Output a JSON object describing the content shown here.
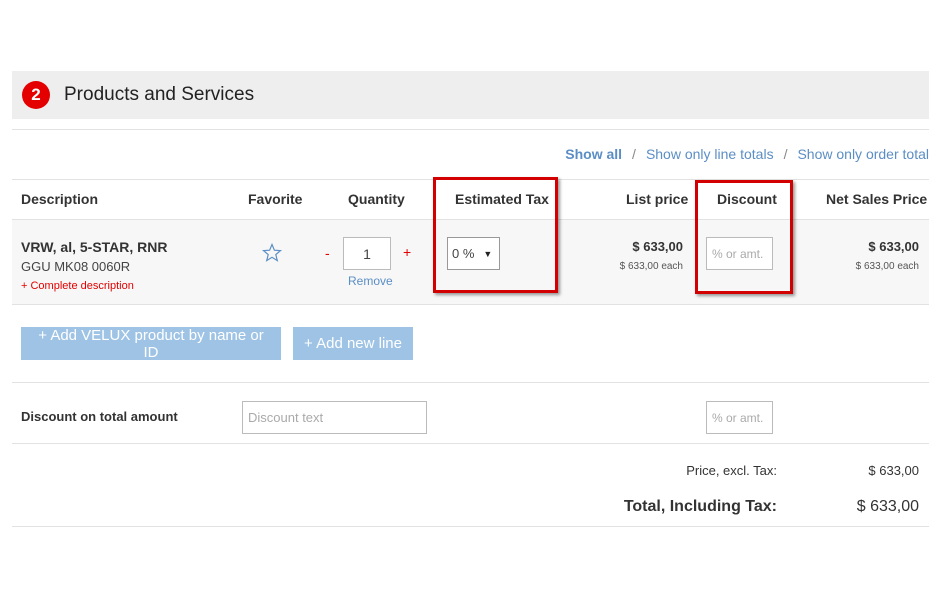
{
  "section": {
    "step": "2",
    "title": "Products and Services"
  },
  "view_links": {
    "show_all": "Show all",
    "line_totals": "Show only line totals",
    "order_total": "Show only order total",
    "separator": "/"
  },
  "columns": {
    "description": "Description",
    "favorite": "Favorite",
    "quantity": "Quantity",
    "estimated_tax": "Estimated Tax",
    "list_price": "List price",
    "discount": "Discount",
    "net_sales_price": "Net Sales Price"
  },
  "item": {
    "name": "VRW, al, 5-STAR, RNR",
    "code": "GGU MK08 0060R",
    "complete_description": "+ Complete description",
    "favorite_icon": "star-outline-icon",
    "qty_minus": "-",
    "qty_plus": "+",
    "quantity": "1",
    "remove": "Remove",
    "tax_value": "0 %",
    "tax_caret": "▼",
    "list_price": "$ 633,00",
    "list_price_each": "$ 633,00 each",
    "discount_placeholder": "% or amt.",
    "net_price": "$ 633,00",
    "net_price_each": "$ 633,00 each"
  },
  "buttons": {
    "add_product": "+ Add VELUX product by name or ID",
    "add_line": "+ Add new line"
  },
  "order_discount": {
    "label": "Discount on total amount",
    "text_placeholder": "Discount text",
    "amount_placeholder": "% or amt."
  },
  "totals": {
    "subtotal_label": "Price, excl. Tax:",
    "subtotal_value": "$ 633,00",
    "total_label": "Total, Including Tax:",
    "total_value": "$ 633,00"
  },
  "colors": {
    "accent_red": "#e40000",
    "link_blue": "#5b8ec5",
    "button_blue": "#9ec3e4",
    "highlight_box": "#d20000"
  }
}
